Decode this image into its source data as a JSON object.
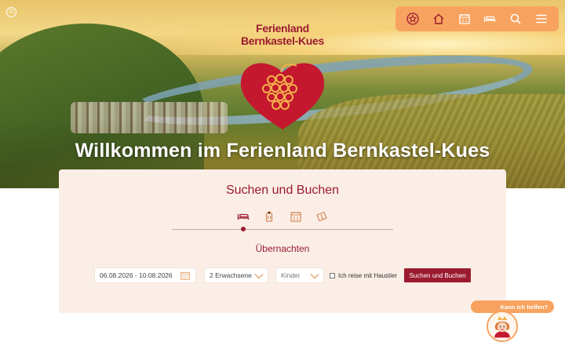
{
  "brand": {
    "line1": "Ferienland",
    "line2": "Bernkastel-Kues"
  },
  "hero": {
    "title": "Willkommen im Ferienland Bernkastel-Kues"
  },
  "nav": {
    "icons": [
      "star-icon",
      "home-icon",
      "calendar-icon",
      "bed-icon",
      "search-icon",
      "menu-icon"
    ]
  },
  "search": {
    "title": "Suchen und Buchen",
    "tabs": [
      "bed-icon",
      "luggage-icon",
      "calendar-icon",
      "ticket-icon"
    ],
    "active_tab": "Übernachten",
    "date_range": "06.08.2026 - 10.08.2026",
    "adults": "2 Erwachsene",
    "children_placeholder": "Kinder",
    "pet_label": "Ich reise mit Haustier",
    "submit_label": "Suchen und Buchen"
  },
  "help": {
    "bubble": "Kann ich helfen?"
  },
  "colors": {
    "accent": "#9b1b30",
    "nav_bg": "#f7a35f",
    "panel_bg": "#fbeee6"
  }
}
